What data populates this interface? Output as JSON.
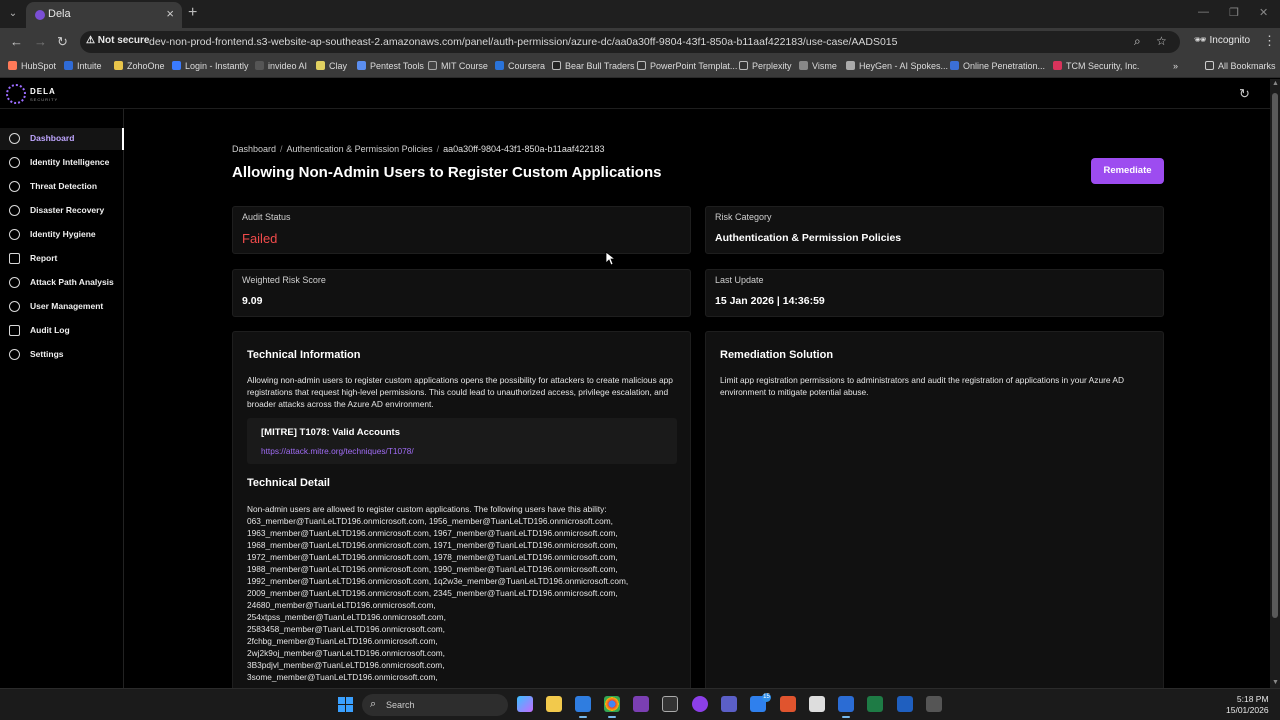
{
  "browser": {
    "tab_title": "Dela",
    "not_secure": "Not secure",
    "url": "dev-non-prod-frontend.s3-website-ap-southeast-2.amazonaws.com/panel/auth-permission/azure-dc/aa0a30ff-9804-43f1-850a-b11aaf422183/use-case/AADS015",
    "incognito": "Incognito",
    "bookmarks": [
      "HubSpot",
      "Intuite",
      "ZohoOne",
      "Login - Instantly",
      "invideo AI",
      "Clay",
      "Pentest Tools",
      "MIT Course",
      "Coursera",
      "Bear Bull Traders",
      "PowerPoint Templat...",
      "Perplexity",
      "Visme",
      "HeyGen - AI Spokes...",
      "Online Penetration...",
      "TCM Security, Inc."
    ],
    "all_bookmarks": "All Bookmarks"
  },
  "app": {
    "logo_text": "DELA",
    "logo_sub": "SECURITY"
  },
  "sidebar": {
    "items": [
      {
        "label": "Dashboard"
      },
      {
        "label": "Identity Intelligence"
      },
      {
        "label": "Threat Detection"
      },
      {
        "label": "Disaster Recovery"
      },
      {
        "label": "Identity Hygiene"
      },
      {
        "label": "Report"
      },
      {
        "label": "Attack Path Analysis"
      },
      {
        "label": "User Management"
      },
      {
        "label": "Audit Log"
      },
      {
        "label": "Settings"
      }
    ]
  },
  "breadcrumb": {
    "items": [
      "Dashboard",
      "Authentication & Permission Policies",
      "aa0a30ff-9804-43f1-850a-b11aaf422183"
    ]
  },
  "page": {
    "title": "Allowing Non-Admin Users to Register Custom Applications",
    "remediate_label": "Remediate"
  },
  "cards": {
    "audit_status_label": "Audit Status",
    "audit_status_value": "Failed",
    "risk_category_label": "Risk Category",
    "risk_category_value": "Authentication & Permission Policies",
    "risk_score_label": "Weighted Risk Score",
    "risk_score_value": "9.09",
    "last_update_label": "Last Update",
    "last_update_value": "15 Jan 2026 | 14:36:59"
  },
  "technical": {
    "title": "Technical Information",
    "description": "Allowing non-admin users to register custom applications opens the possibility for attackers to create malicious app registrations that request high-level permissions. This could lead to unauthorized access, privilege escalation, and broader attacks across the Azure AD environment.",
    "mitre_title": "[MITRE] T1078: Valid Accounts",
    "mitre_link": "https://attack.mitre.org/techniques/T1078/",
    "detail_title": "Technical Detail",
    "detail_intro": "Non-admin users are allowed to register custom applications. The following users have this ability:",
    "users": [
      "063_member@TuanLeLTD196.onmicrosoft.com, 1956_member@TuanLeLTD196.onmicrosoft.com,",
      "1963_member@TuanLeLTD196.onmicrosoft.com, 1967_member@TuanLeLTD196.onmicrosoft.com,",
      "1968_member@TuanLeLTD196.onmicrosoft.com, 1971_member@TuanLeLTD196.onmicrosoft.com,",
      "1972_member@TuanLeLTD196.onmicrosoft.com, 1978_member@TuanLeLTD196.onmicrosoft.com,",
      "1988_member@TuanLeLTD196.onmicrosoft.com, 1990_member@TuanLeLTD196.onmicrosoft.com,",
      "1992_member@TuanLeLTD196.onmicrosoft.com, 1q2w3e_member@TuanLeLTD196.onmicrosoft.com,",
      "2009_member@TuanLeLTD196.onmicrosoft.com, 2345_member@TuanLeLTD196.onmicrosoft.com,",
      "24680_member@TuanLeLTD196.onmicrosoft.com,",
      "254xtpss_member@TuanLeLTD196.onmicrosoft.com,",
      "2583458_member@TuanLeLTD196.onmicrosoft.com,",
      "2fchbg_member@TuanLeLTD196.onmicrosoft.com,",
      "2wj2k9oj_member@TuanLeLTD196.onmicrosoft.com,",
      "3B3pdjvl_member@TuanLeLTD196.onmicrosoft.com,",
      "3some_member@TuanLeLTD196.onmicrosoft.com,"
    ]
  },
  "remediation": {
    "title": "Remediation Solution",
    "text": "Limit app registration permissions to administrators and audit the registration of applications in your Azure AD environment to mitigate potential abuse."
  },
  "taskbar": {
    "search_placeholder": "Search",
    "time": "5:18 PM",
    "date": "15/01/2026",
    "badge_count": "15"
  }
}
